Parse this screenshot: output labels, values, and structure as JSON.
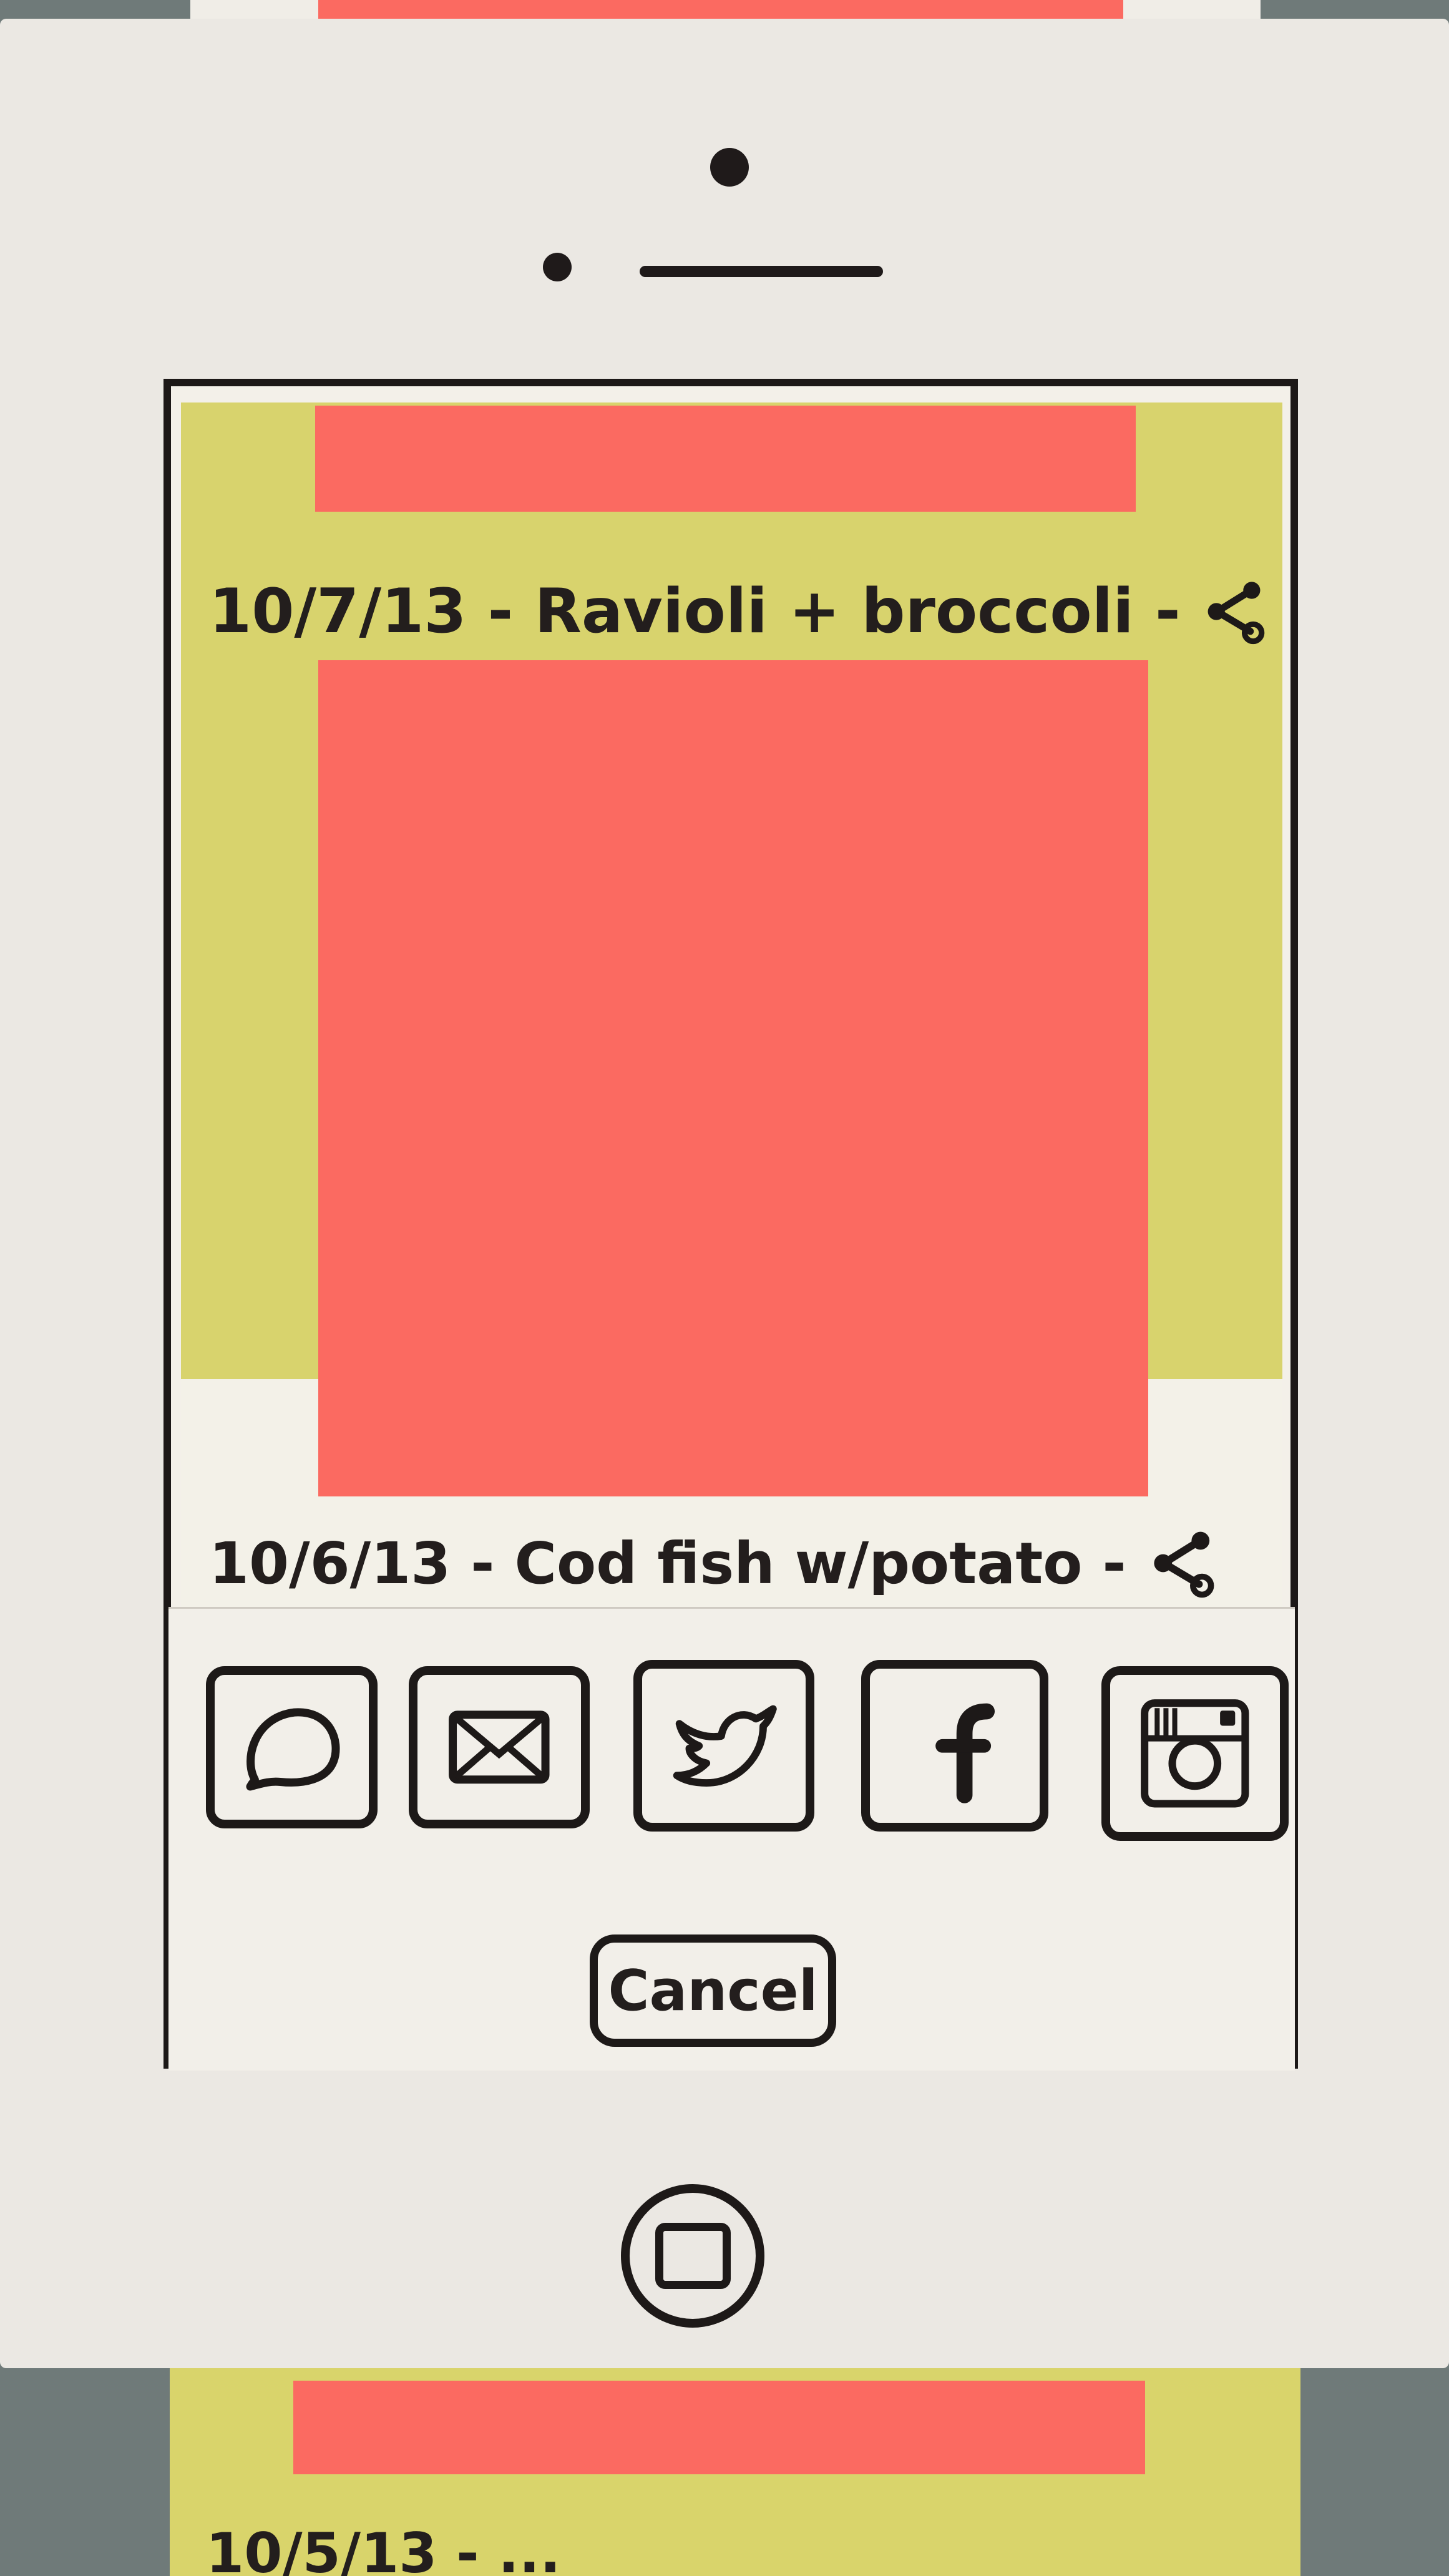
{
  "feed": {
    "items": [
      {
        "caption": "10/7/13 - Ravioli + broccoli -"
      },
      {
        "caption": "10/6/13 - Cod fish w/potato -"
      },
      {
        "caption": "10/5/13 - ..."
      }
    ]
  },
  "share_sheet": {
    "options": [
      {
        "name": "messages",
        "icon": "speech-bubble-icon"
      },
      {
        "name": "email",
        "icon": "envelope-icon"
      },
      {
        "name": "twitter",
        "icon": "twitter-bird-icon"
      },
      {
        "name": "facebook",
        "icon": "facebook-f-icon"
      },
      {
        "name": "instagram",
        "icon": "instagram-camera-icon"
      }
    ],
    "cancel_label": "Cancel"
  },
  "colors": {
    "photo_placeholder": "#fb6a61",
    "feed_background": "#d8d36d",
    "paper": "#ebe8e3",
    "ink": "#1d1918"
  }
}
